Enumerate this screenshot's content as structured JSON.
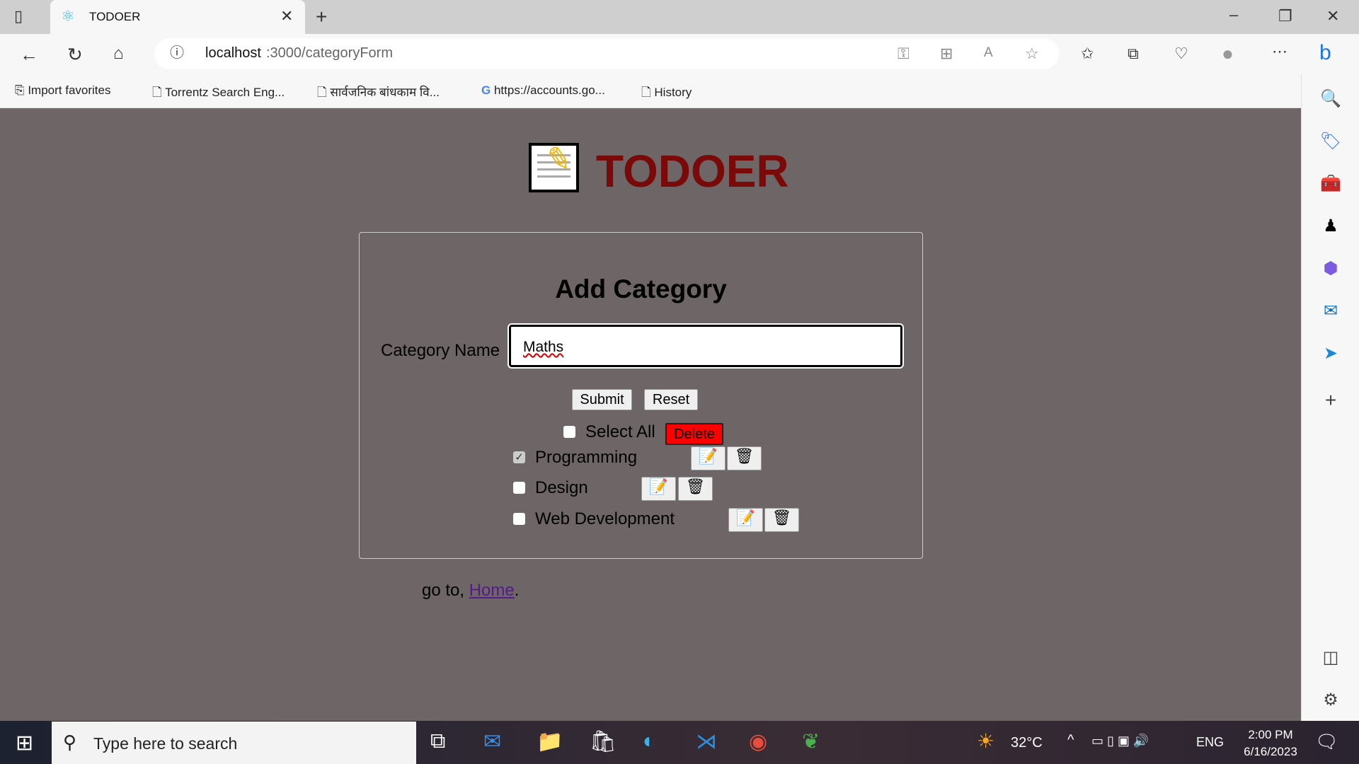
{
  "browser": {
    "tab_title": "TODOER",
    "url_host": "localhost",
    "url_path": ":3000/categoryForm",
    "bookmarks": [
      "Import favorites",
      "Torrentz Search Eng...",
      "सार्वजनिक बांधकाम वि...",
      "https://accounts.go...",
      "History"
    ]
  },
  "page": {
    "app_title": "TODOER",
    "form_title": "Add Category",
    "field_label": "Category Name",
    "field_value": "Maths",
    "submit_label": "Submit",
    "reset_label": "Reset",
    "select_all_label": "Select All",
    "delete_label": "Delete",
    "categories": [
      {
        "name": "Programming",
        "checked": true
      },
      {
        "name": "Design",
        "checked": false
      },
      {
        "name": "Web Development",
        "checked": false
      }
    ],
    "footer_prefix": "go to, ",
    "footer_link": "Home",
    "footer_suffix": "."
  },
  "taskbar": {
    "search_placeholder": "Type here to search",
    "temperature": "32°C",
    "language": "ENG",
    "time": "2:00 PM",
    "date": "6/16/2023"
  },
  "colors": {
    "page_bg": "#6e6666",
    "title": "#7a0a0a",
    "delete_bg": "#ff0000",
    "link": "#551a8b"
  }
}
